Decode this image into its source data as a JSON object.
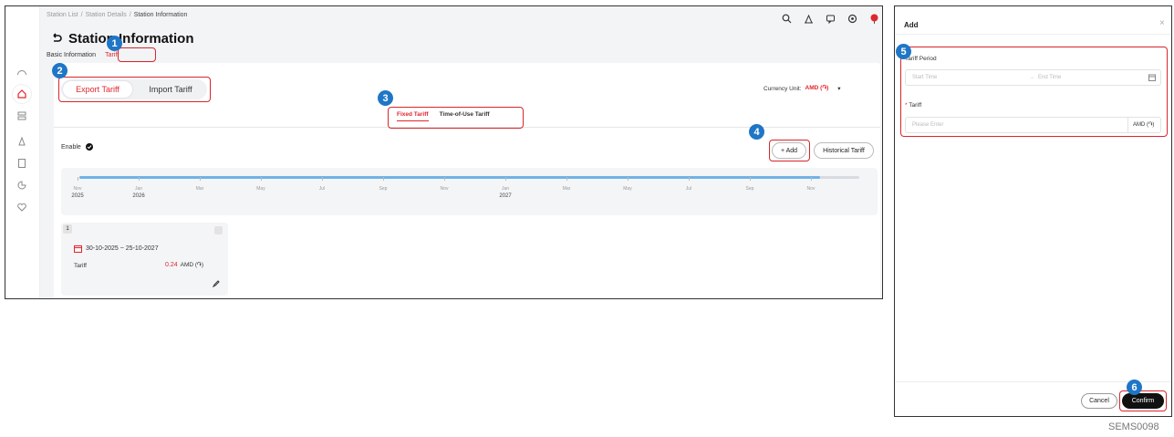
{
  "breadcrumb": [
    "Station List",
    "Station Details",
    "Station Information"
  ],
  "page_title": "Station Information",
  "sub_tabs": [
    "Basic Information",
    "Tariff"
  ],
  "tariff_direction": {
    "export": "Export Tariff",
    "import": "Import Tariff"
  },
  "currency": {
    "label": "Currency Unit:",
    "value": "AMD (֏)"
  },
  "tariff_mode": {
    "fixed": "Fixed Tariff",
    "tou": "Time-of-Use Tariff"
  },
  "enable_label": "Enable",
  "buttons": {
    "add": "+ Add",
    "historical": "Historical Tariff"
  },
  "timeline": {
    "months": [
      "Nov",
      "Jan",
      "Mar",
      "May",
      "Jul",
      "Sep",
      "Nov",
      "Jan",
      "Mar",
      "May",
      "Jul",
      "Sep",
      "Nov"
    ],
    "years": {
      "y2025": "2025",
      "y2026": "2026",
      "y2027": "2027"
    },
    "coverage_fraction": 0.95
  },
  "tariff_card": {
    "index": "1",
    "date_range": "30-10-2025 ~ 25-10-2027",
    "tariff_label": "Tariff",
    "tariff_value": "0.24",
    "tariff_unit": "AMD (֏)"
  },
  "dialog": {
    "title": "Add",
    "period_label": "Tariff Period",
    "start_placeholder": "Start Time",
    "arrow": "→",
    "end_placeholder": "End Time",
    "tariff_label": "Tariff",
    "tariff_placeholder": "Please Enter",
    "unit": "AMD (֏)",
    "cancel": "Cancel",
    "confirm": "Confirm"
  },
  "callout_numbers": [
    "1",
    "2",
    "3",
    "4",
    "5",
    "6"
  ],
  "figure_code": "SEMS0098",
  "colors": {
    "accent": "#e0262d",
    "badge": "#1f76c6",
    "timeline": "#6fb3e6"
  },
  "icons": [
    "speedometer-icon",
    "home-icon",
    "server-icon",
    "device-icon",
    "report-icon",
    "chart-icon",
    "heart-icon",
    "search-icon",
    "alarm-icon",
    "message-icon",
    "settings-icon",
    "avatar"
  ]
}
